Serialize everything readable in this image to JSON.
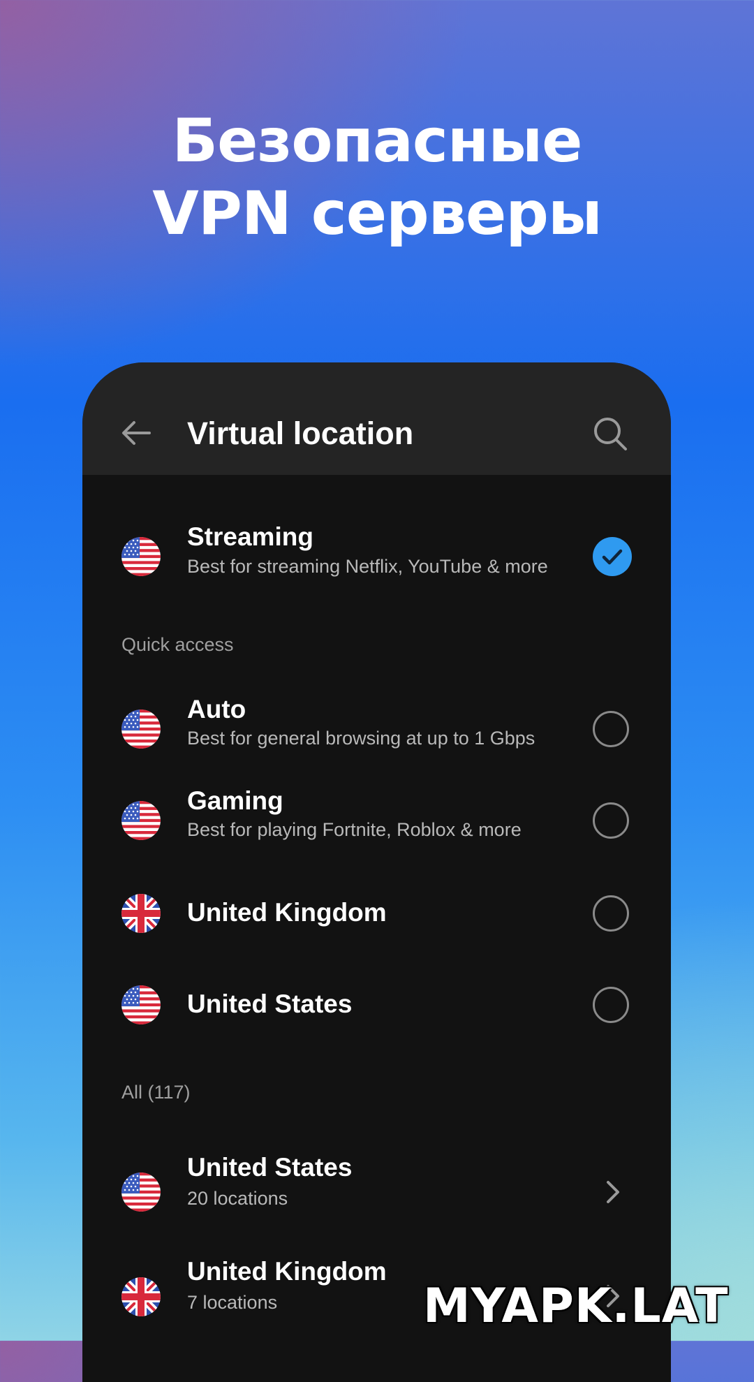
{
  "promo": {
    "headline_line1": "Безопасные",
    "headline_line2": "VPN серверы"
  },
  "appbar": {
    "title": "Virtual location",
    "back_icon": "arrow-back-icon",
    "search_icon": "search-icon"
  },
  "selected": {
    "title": "Streaming",
    "subtitle": "Best for streaming Netflix, YouTube & more",
    "flag": "us-flag-icon",
    "state": "checked"
  },
  "quick_access": {
    "label": "Quick access",
    "items": [
      {
        "title": "Auto",
        "subtitle": "Best for general browsing at up to 1 Gbps",
        "flag": "us-flag-icon"
      },
      {
        "title": "Gaming",
        "subtitle": "Best for playing Fortnite, Roblox & more",
        "flag": "us-flag-icon"
      },
      {
        "title": "United Kingdom",
        "subtitle": "",
        "flag": "uk-flag-icon"
      },
      {
        "title": "United States",
        "subtitle": "",
        "flag": "us-flag-icon"
      }
    ]
  },
  "all": {
    "label": "All (117)",
    "items": [
      {
        "title": "United States",
        "subtitle": "20 locations",
        "flag": "us-flag-icon"
      },
      {
        "title": "United Kingdom",
        "subtitle": "7 locations",
        "flag": "uk-flag-icon"
      }
    ]
  },
  "watermark": "MYAPK.LAT",
  "colors": {
    "accent": "#2f9af0",
    "panel": "#121212",
    "appbar": "#242424"
  }
}
